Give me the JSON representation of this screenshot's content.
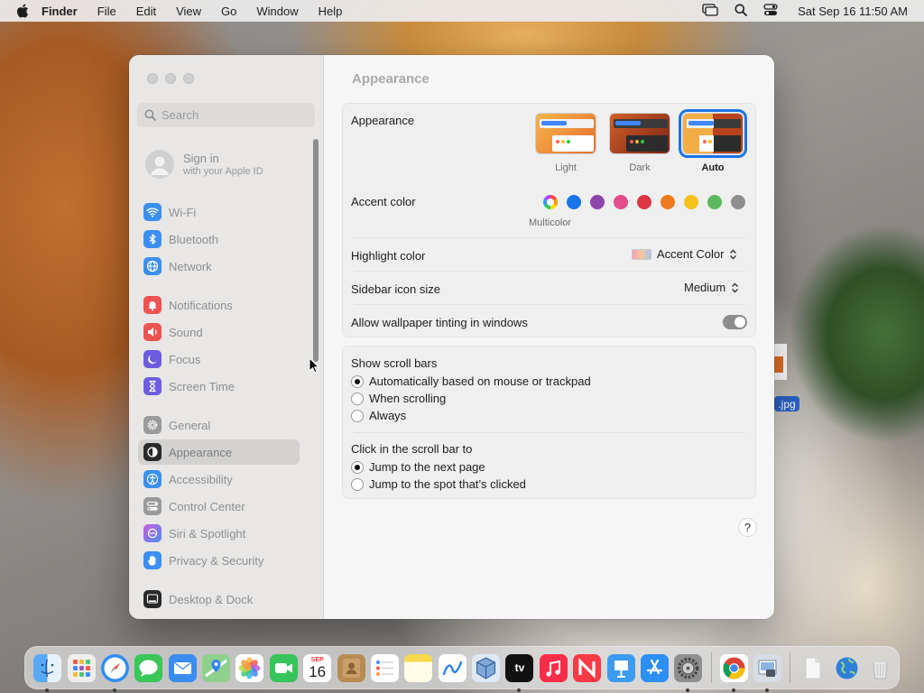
{
  "menubar": {
    "apple": "apple-logo-icon",
    "app_name": "Finder",
    "menus": [
      "File",
      "Edit",
      "View",
      "Go",
      "Window",
      "Help"
    ],
    "datetime": "Sat Sep 16  11:50 AM"
  },
  "sidebar": {
    "search_placeholder": "Search",
    "signin_title": "Sign in",
    "signin_subtitle": "with your Apple ID",
    "items": [
      {
        "label": "Wi-Fi",
        "icon": "wifi-icon",
        "color": "#3b8ff0"
      },
      {
        "label": "Bluetooth",
        "icon": "bluetooth-icon",
        "color": "#3b8ff0"
      },
      {
        "label": "Network",
        "icon": "globe-icon",
        "color": "#3b8ff0"
      },
      {
        "label": "Notifications",
        "icon": "bell-icon",
        "color": "#ef5350"
      },
      {
        "label": "Sound",
        "icon": "speaker-icon",
        "color": "#ef5350"
      },
      {
        "label": "Focus",
        "icon": "moon-icon",
        "color": "#6e5ce0"
      },
      {
        "label": "Screen Time",
        "icon": "hourglass-icon",
        "color": "#6e5ce0"
      },
      {
        "label": "General",
        "icon": "gear-icon",
        "color": "#9a9a9a"
      },
      {
        "label": "Appearance",
        "icon": "appearance-icon",
        "color": "#2a2a2a"
      },
      {
        "label": "Accessibility",
        "icon": "accessibility-icon",
        "color": "#3b8ff0"
      },
      {
        "label": "Control Center",
        "icon": "switches-icon",
        "color": "#9a9a9a"
      },
      {
        "label": "Siri & Spotlight",
        "icon": "siri-icon",
        "color": "#b455d9"
      },
      {
        "label": "Privacy & Security",
        "icon": "hand-icon",
        "color": "#3b8ff0"
      },
      {
        "label": "Desktop & Dock",
        "icon": "dock-icon",
        "color": "#2a2a2a"
      }
    ],
    "selected_index": 8
  },
  "main": {
    "title": "Appearance",
    "appearance_label": "Appearance",
    "themes": [
      {
        "label": "Light",
        "selected": false
      },
      {
        "label": "Dark",
        "selected": false
      },
      {
        "label": "Auto",
        "selected": true
      }
    ],
    "accent_label": "Accent color",
    "accent_colors": [
      "multicolor",
      "#1a73e8",
      "#8e44ad",
      "#e64b8c",
      "#dc3545",
      "#ef7b1e",
      "#f4c21c",
      "#5cb85c",
      "#8e8e8e"
    ],
    "accent_selected_caption": "Multicolor",
    "highlight_label": "Highlight color",
    "highlight_value": "Accent Color",
    "sidebar_icon_label": "Sidebar icon size",
    "sidebar_icon_value": "Medium",
    "tinting_label": "Allow wallpaper tinting in windows",
    "tinting_enabled": true,
    "scrollbars_label": "Show scroll bars",
    "scrollbar_options": [
      "Automatically based on mouse or trackpad",
      "When scrolling",
      "Always"
    ],
    "scrollbar_selected": 0,
    "click_label": "Click in the scroll bar to",
    "click_options": [
      "Jump to the next page",
      "Jump to the spot that’s clicked"
    ],
    "click_selected": 0,
    "help": "?"
  },
  "desktop": {
    "file_label": ".jpg"
  },
  "dock": {
    "calendar_month": "SEP",
    "calendar_day": "16",
    "tv_label": "tv",
    "apps": [
      {
        "name": "finder-icon",
        "color": "#3d8ff2",
        "running": true
      },
      {
        "name": "launchpad-icon",
        "color": "#eeeeee",
        "running": false
      },
      {
        "name": "safari-icon",
        "color": "#2f8ef5",
        "running": true
      },
      {
        "name": "messages-icon",
        "color": "#39c758",
        "running": false
      },
      {
        "name": "mail-icon",
        "color": "#3a8cf0",
        "running": false
      },
      {
        "name": "maps-icon",
        "color": "#5bbd5a",
        "running": false
      },
      {
        "name": "photos-icon",
        "color": "#ffffff",
        "running": false
      },
      {
        "name": "facetime-icon",
        "color": "#35c55a",
        "running": false
      },
      {
        "name": "calendar-icon",
        "color": "#ffffff",
        "running": false
      },
      {
        "name": "contacts-icon",
        "color": "#b78b52",
        "running": false
      },
      {
        "name": "reminders-icon",
        "color": "#ffffff",
        "running": false
      },
      {
        "name": "notes-icon",
        "color": "#fbe27a",
        "running": false
      },
      {
        "name": "freeform-icon",
        "color": "#ffffff",
        "running": false
      },
      {
        "name": "virtualbox-icon",
        "color": "#dfe9f5",
        "running": false
      },
      {
        "name": "apple-tv-icon",
        "color": "#111111",
        "running": true
      },
      {
        "name": "music-icon",
        "color": "#fa2d48",
        "running": false
      },
      {
        "name": "news-icon",
        "color": "#fa3a46",
        "running": false
      },
      {
        "name": "keynote-icon",
        "color": "#3c9bf0",
        "running": false
      },
      {
        "name": "app-store-icon",
        "color": "#2d8ff5",
        "running": false
      },
      {
        "name": "system-settings-icon",
        "color": "#8f8f8f",
        "running": true
      },
      {
        "name": "chrome-icon",
        "color": "#ffffff",
        "running": true
      },
      {
        "name": "preview-icon",
        "color": "#d7dde6",
        "running": true
      },
      {
        "name": "document-icon",
        "color": "#f4f4f4",
        "running": false
      },
      {
        "name": "network-globe-icon",
        "color": "#2f7fd8",
        "running": false
      },
      {
        "name": "trash-icon",
        "color": "#e8e8e8",
        "running": false
      }
    ]
  }
}
